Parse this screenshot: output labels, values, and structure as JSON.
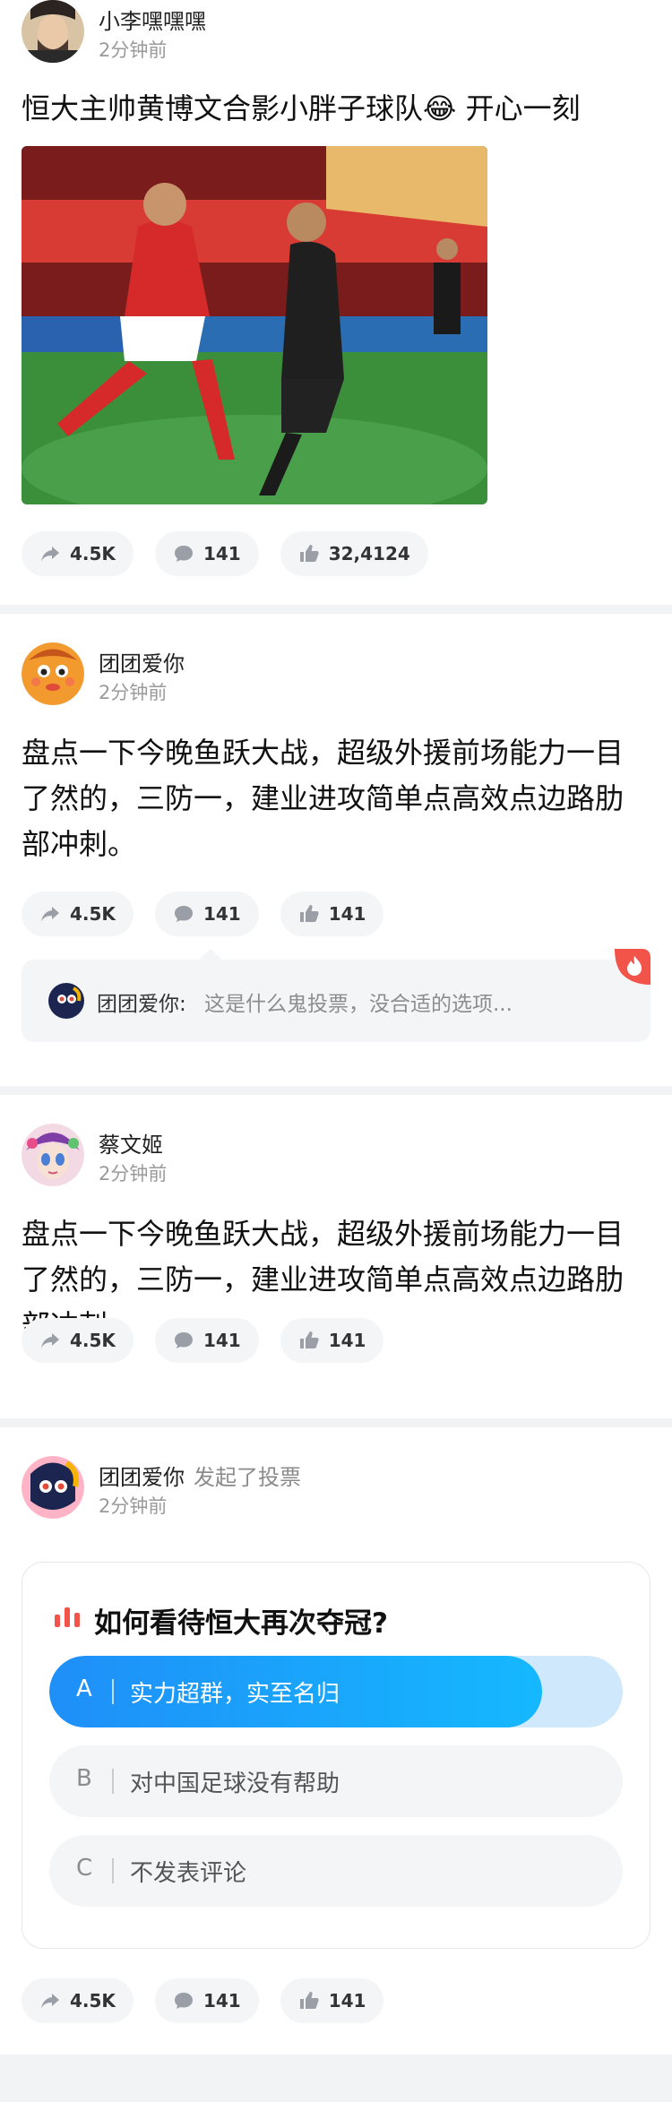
{
  "colors": {
    "accent": "#1f8ff8",
    "hot_badge": "#f2544a",
    "muted": "#9a9a9a"
  },
  "posts": [
    {
      "user": {
        "name": "小李嘿嘿嘿",
        "time": "2分钟前"
      },
      "text": "恒大主帅黄博文合影小胖子球队😂 开心一刻",
      "actions": {
        "shares": "4.5K",
        "comments": "141",
        "likes": "32,4124"
      }
    },
    {
      "user": {
        "name": "团团爱你",
        "time": "2分钟前"
      },
      "text": "盘点一下今晚鱼跃大战，超级外援前场能力一目了然的，三防一，建业进攻简单点高效点边路肋部冲刺。",
      "actions": {
        "shares": "4.5K",
        "comments": "141",
        "likes": "141"
      },
      "top_comment": {
        "author": "团团爱你:",
        "text": "这是什么鬼投票，没合适的选项..."
      }
    },
    {
      "user": {
        "name": "蔡文姬",
        "time": "2分钟前"
      },
      "text": "盘点一下今晚鱼跃大战，超级外援前场能力一目了然的，三防一，建业进攻简单点高效点边路肋部冲刺。",
      "actions": {
        "shares": "4.5K",
        "comments": "141",
        "likes": "141"
      }
    },
    {
      "user": {
        "name": "团团爱你",
        "action": "发起了投票",
        "time": "2分钟前"
      },
      "poll": {
        "title": "如何看待恒大再次夺冠?",
        "options": [
          {
            "letter": "A",
            "text": "实力超群，实至名归",
            "selected": true,
            "share": 0.86
          },
          {
            "letter": "B",
            "text": "对中国足球没有帮助",
            "selected": false
          },
          {
            "letter": "C",
            "text": "不发表评论",
            "selected": false
          }
        ]
      },
      "actions": {
        "shares": "4.5K",
        "comments": "141",
        "likes": "141"
      }
    }
  ]
}
